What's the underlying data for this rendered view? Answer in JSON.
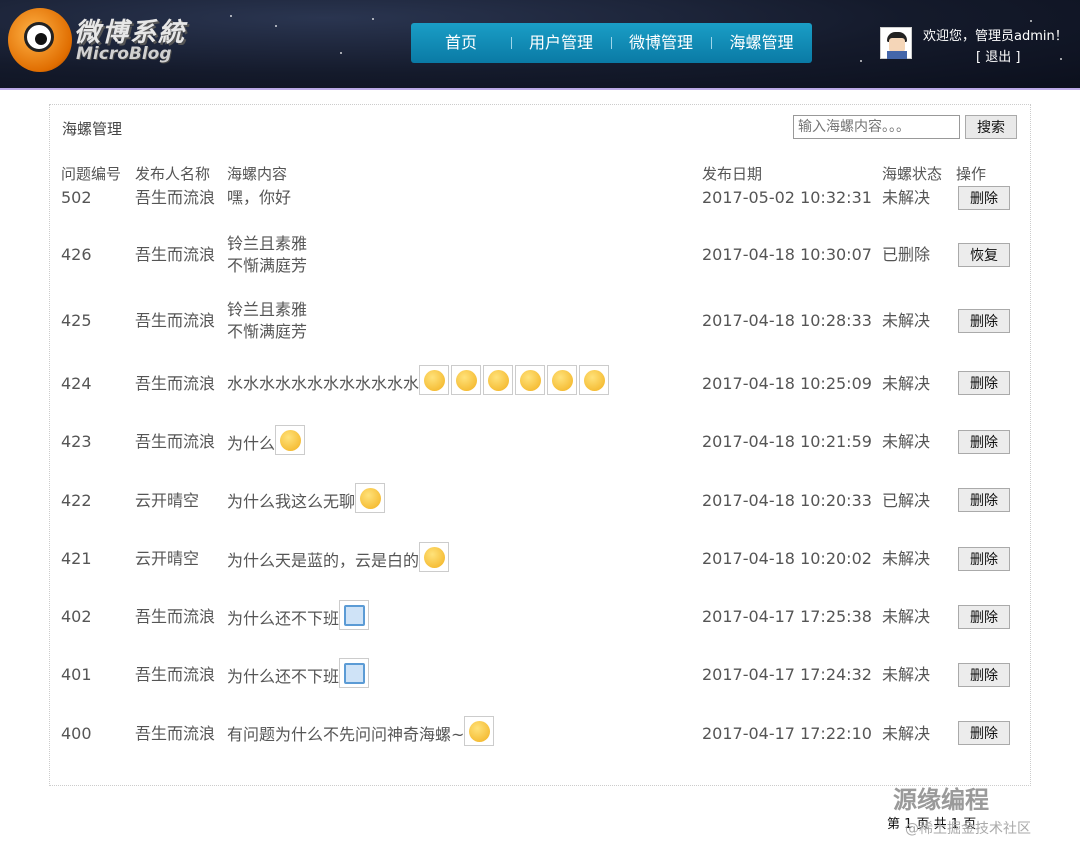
{
  "header": {
    "logo_cn": "微博系統",
    "logo_en": "MicroBlog",
    "nav": [
      "首页",
      "用户管理",
      "微博管理",
      "海螺管理"
    ],
    "welcome": "欢迎您，管理员admin！",
    "logout": "[ 退出 ]"
  },
  "panel": {
    "title": "海螺管理",
    "search_placeholder": "输入海螺内容。。。",
    "search_button": "搜索"
  },
  "table": {
    "headers": [
      "问题编号",
      "发布人名称",
      "海螺内容",
      "发布日期",
      "海螺状态",
      "操作"
    ],
    "rows": [
      {
        "id": "502",
        "author": "吾生而流浪",
        "line1": "嘿，你好",
        "line2": "",
        "date": "2017-05-02 10:32:31",
        "status": "未解决",
        "op": "删除"
      },
      {
        "id": "426",
        "author": "吾生而流浪",
        "line1": "铃兰且素雅",
        "line2": "不惭满庭芳",
        "date": "2017-04-18 10:30:07",
        "status": "已删除",
        "op": "恢复"
      },
      {
        "id": "425",
        "author": "吾生而流浪",
        "line1": "铃兰且素雅",
        "line2": "不惭满庭芳",
        "date": "2017-04-18 10:28:33",
        "status": "未解决",
        "op": "删除"
      },
      {
        "id": "424",
        "author": "吾生而流浪",
        "line1": "水水水水水水水水水水水水",
        "line2": "",
        "date": "2017-04-18 10:25:09",
        "status": "未解决",
        "op": "删除"
      },
      {
        "id": "423",
        "author": "吾生而流浪",
        "line1": "为什么",
        "line2": "",
        "date": "2017-04-18 10:21:59",
        "status": "未解决",
        "op": "删除"
      },
      {
        "id": "422",
        "author": "云开晴空",
        "line1": "为什么我这么无聊",
        "line2": "",
        "date": "2017-04-18 10:20:33",
        "status": "已解决",
        "op": "删除"
      },
      {
        "id": "421",
        "author": "云开晴空",
        "line1": "为什么天是蓝的，云是白的",
        "line2": "",
        "date": "2017-04-18 10:20:02",
        "status": "未解决",
        "op": "删除"
      },
      {
        "id": "402",
        "author": "吾生而流浪",
        "line1": "为什么还不下班",
        "line2": "",
        "date": "2017-04-17 17:25:38",
        "status": "未解决",
        "op": "删除"
      },
      {
        "id": "401",
        "author": "吾生而流浪",
        "line1": "为什么还不下班",
        "line2": "",
        "date": "2017-04-17 17:24:32",
        "status": "未解决",
        "op": "删除"
      },
      {
        "id": "400",
        "author": "吾生而流浪",
        "line1": "有问题为什么不先问问神奇海螺~",
        "line2": "",
        "date": "2017-04-17 17:22:10",
        "status": "未解决",
        "op": "删除"
      }
    ]
  },
  "footer": {
    "pagination": "第 1 页   共 1 页"
  },
  "watermark": {
    "brand": "源缘编程",
    "community": "@稀土掘金技术社区"
  }
}
